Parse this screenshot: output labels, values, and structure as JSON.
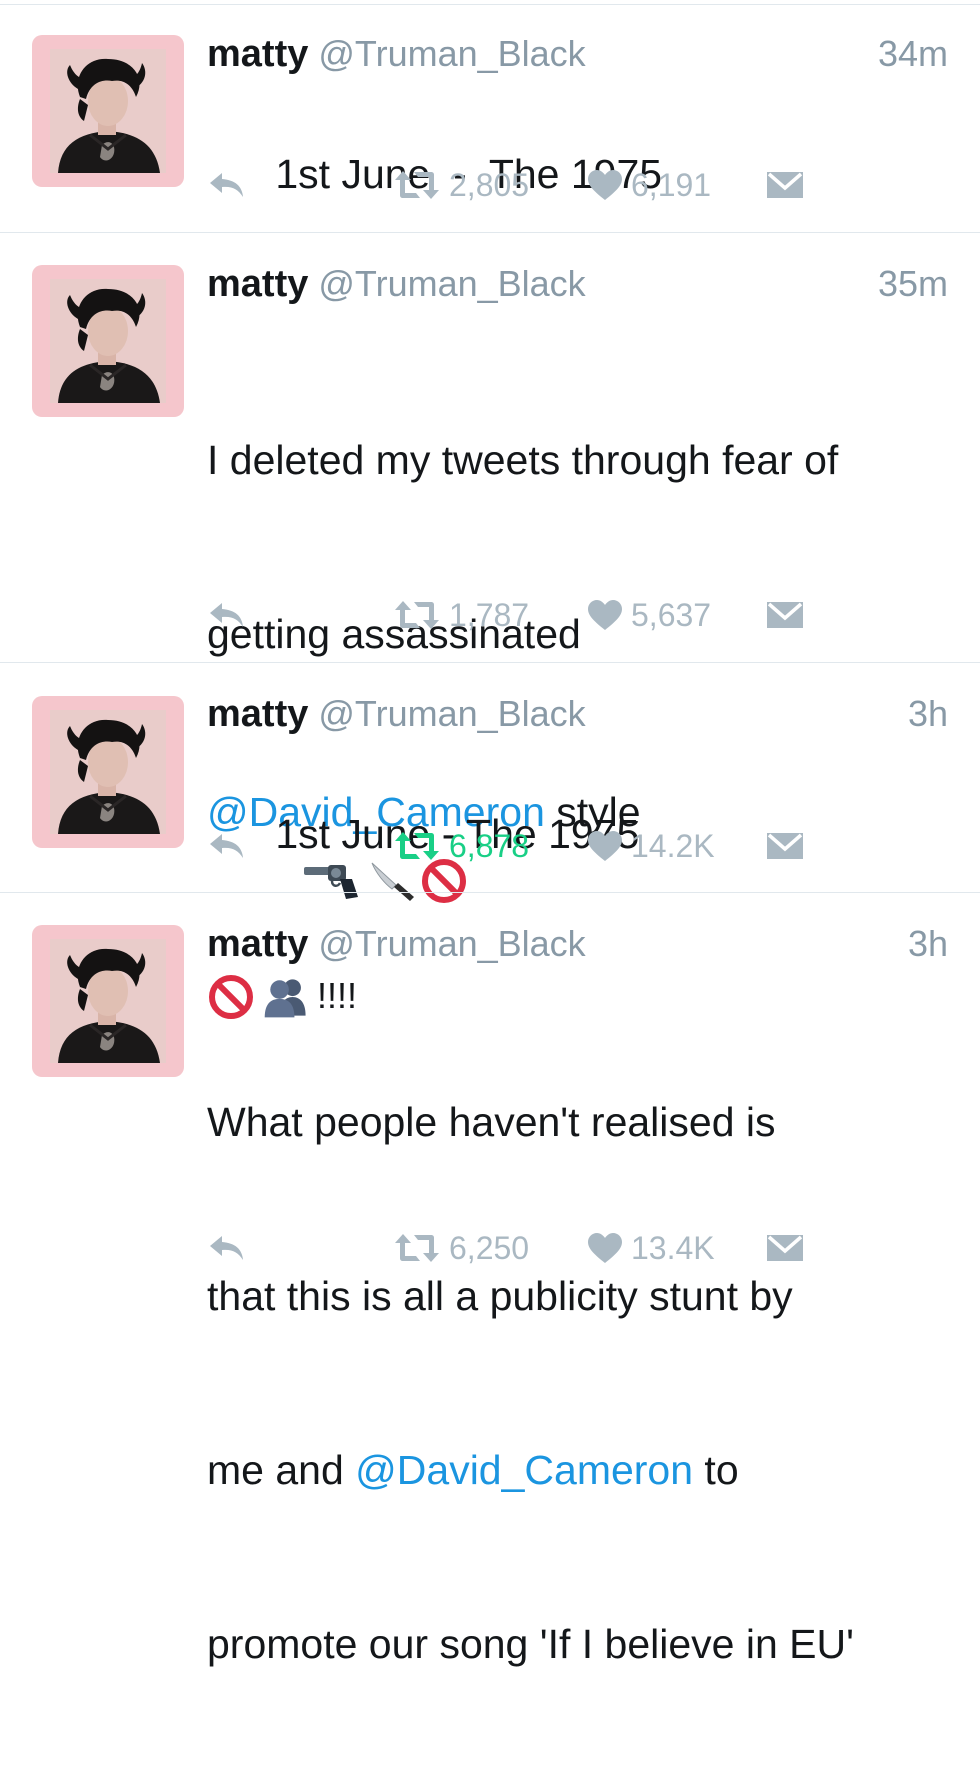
{
  "colors": {
    "text": "#14171a",
    "secondary": "#8899a6",
    "mention": "#1b95e0",
    "retweet_active": "#19cf86",
    "icon": "#aab8c2",
    "divider": "#e1e8ed",
    "avatar_frame": "#f5c6cc"
  },
  "tweets": [
    {
      "name": "matty",
      "handle": "@Truman_Black",
      "time": "34m",
      "text": "1st June  -  The 1975",
      "retweets": "2,805",
      "likes": "6,191",
      "retweeted": false
    },
    {
      "name": "matty",
      "handle": "@Truman_Black",
      "time": "35m",
      "line1": "I deleted my tweets through fear of",
      "line2": "getting assassinated",
      "mention": "@David_Cameron",
      "after_mention": " style",
      "emoji_line1": [
        "pistol-emoji",
        "knife-emoji",
        "no-entry-emoji"
      ],
      "emoji_line2": [
        "no-entry-emoji",
        "busts-in-silhouette-emoji"
      ],
      "exclaim": "!!!!",
      "retweets": "1,787",
      "likes": "5,637",
      "retweeted": false
    },
    {
      "name": "matty",
      "handle": "@Truman_Black",
      "time": "3h",
      "text": "1st June - The 1975",
      "retweets": "6,878",
      "likes": "14.2K",
      "retweeted": true
    },
    {
      "name": "matty",
      "handle": "@Truman_Black",
      "time": "3h",
      "line1": "What people haven't realised is",
      "line2": "that this is all a publicity stunt by",
      "line3_pre": "me and ",
      "mention": "@David_Cameron",
      "line3_post": " to",
      "line4": "promote our song 'If I believe in EU'",
      "retweets": "6,250",
      "likes": "13.4K",
      "retweeted": false
    }
  ]
}
